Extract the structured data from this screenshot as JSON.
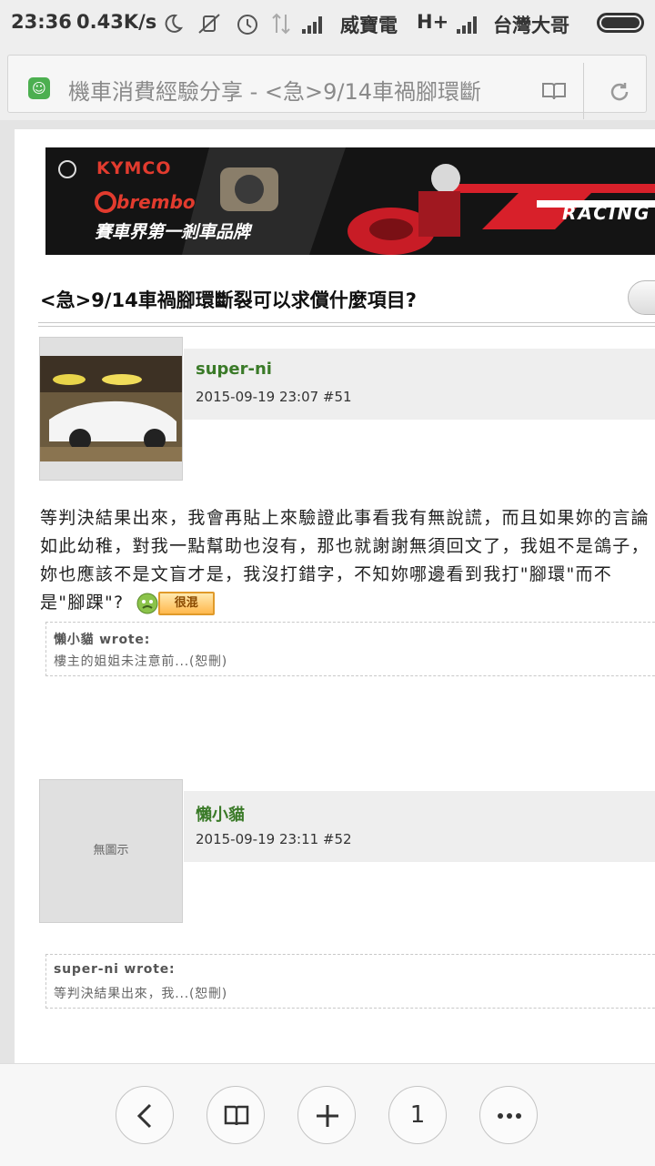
{
  "status_bar": {
    "time": "23:36",
    "speed": "0.43K/s",
    "carrier1": "威寶電",
    "network": "H+",
    "carrier2": "台灣大哥"
  },
  "browser": {
    "page_title": "機車消費經驗分享 - <急>9/14車禍腳環斷",
    "tab_count": "1"
  },
  "banner": {
    "brand1": "KYMCO",
    "brand2": "brembo",
    "slogan": "賽車界第一剎車品牌",
    "racing": "RACING"
  },
  "topic": {
    "title": "<急>9/14車禍腳環斷裂可以求償什麼項目?"
  },
  "posts": [
    {
      "username": "super-ni",
      "meta": "2015-09-19 23:07  #51",
      "body": "等判決結果出來，我會再貼上來驗證此事看我有無說謊，而且如果妳的言論如此幼稚，對我一點幫助也沒有，那也就謝謝無須回文了，我姐不是鴿子，妳也應該不是文盲才是，我沒打錯字，不知妳哪邊看到我打\"腳環\"而不是\"腳踝\"?",
      "badge": "很混",
      "quote_author": "懶小貓 wrote:",
      "quote_text": "樓主的姐姐未注意前...(恕刪)"
    },
    {
      "username": "懶小貓",
      "meta": "2015-09-19 23:11  #52",
      "avatar_text": "無圖示",
      "quote_author": "super-ni wrote:",
      "quote_text": "等判決結果出來，我...(恕刪)"
    }
  ],
  "colors": {
    "username": "#3a7a28",
    "banner_red": "#d8202a"
  }
}
